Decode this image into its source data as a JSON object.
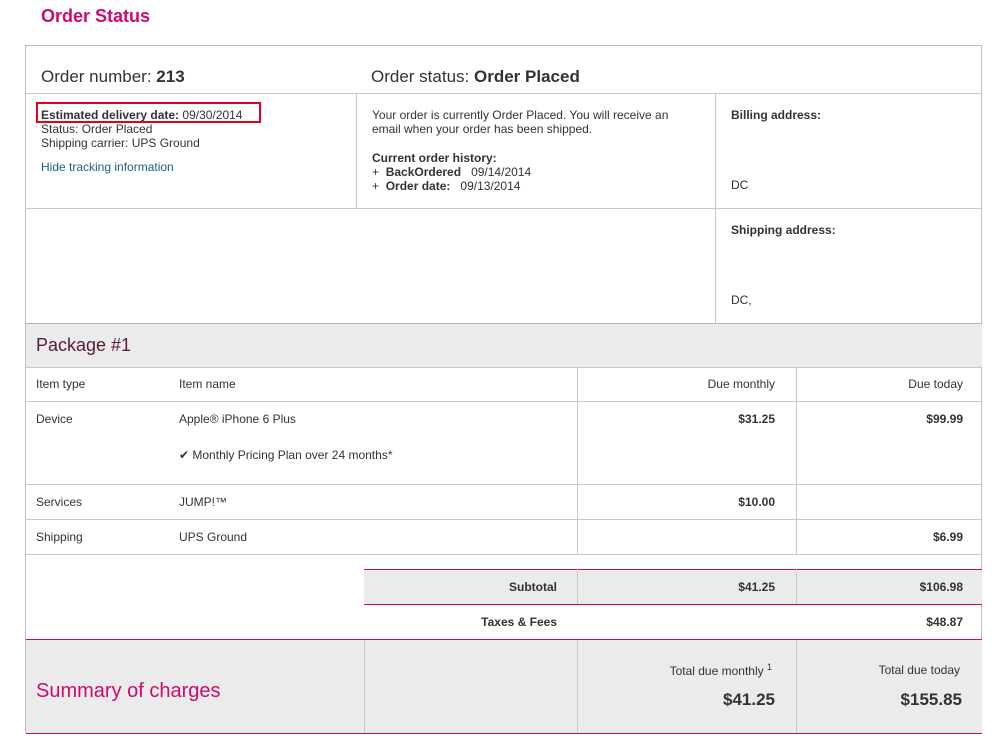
{
  "page_title": "Order Status",
  "order": {
    "number_label": "Order number:",
    "number": "213",
    "status_label": "Order status:",
    "status": "Order Placed"
  },
  "tracking": {
    "eta_label": "Estimated delivery date:",
    "eta_value": "09/30/2014",
    "status_line": "Status:  Order Placed",
    "carrier_line": "Shipping carrier:  UPS Ground",
    "hide_link": "Hide tracking information"
  },
  "status_message": {
    "line1": "Your order is currently Order Placed. You will receive an",
    "line2": "email when your order has been shipped.",
    "history_label": "Current order history:",
    "history": [
      {
        "bullet": "+",
        "label": "BackOrdered",
        "date": "09/14/2014"
      },
      {
        "bullet": "+",
        "label": "Order date:",
        "date": "09/13/2014"
      }
    ]
  },
  "billing": {
    "label": "Billing address:",
    "value": "DC"
  },
  "shipping": {
    "label": "Shipping address:",
    "value": "DC,"
  },
  "package": {
    "title": "Package #1",
    "headers": {
      "item_type": "Item type",
      "item_name": "Item name",
      "due_monthly": "Due monthly",
      "due_today": "Due today"
    },
    "rows": [
      {
        "type": "Device",
        "name": "Apple® iPhone 6 Plus",
        "sub": "✔ Monthly Pricing Plan over 24 months*",
        "monthly": "$31.25",
        "today": "$99.99"
      },
      {
        "type": "Services",
        "name": "JUMP!™",
        "monthly": "$10.00",
        "today": ""
      },
      {
        "type": "Shipping",
        "name": "UPS Ground",
        "monthly": "",
        "today": "$6.99"
      }
    ],
    "subtotal": {
      "label": "Subtotal",
      "monthly": "$41.25",
      "today": "$106.98"
    },
    "taxes": {
      "label": "Taxes & Fees",
      "today": "$48.87"
    }
  },
  "summary": {
    "title": "Summary of charges",
    "monthly_label": "Total due monthly",
    "monthly_sup": "1",
    "monthly_value": "$41.25",
    "today_label": "Total due today",
    "today_value": "$155.85"
  }
}
